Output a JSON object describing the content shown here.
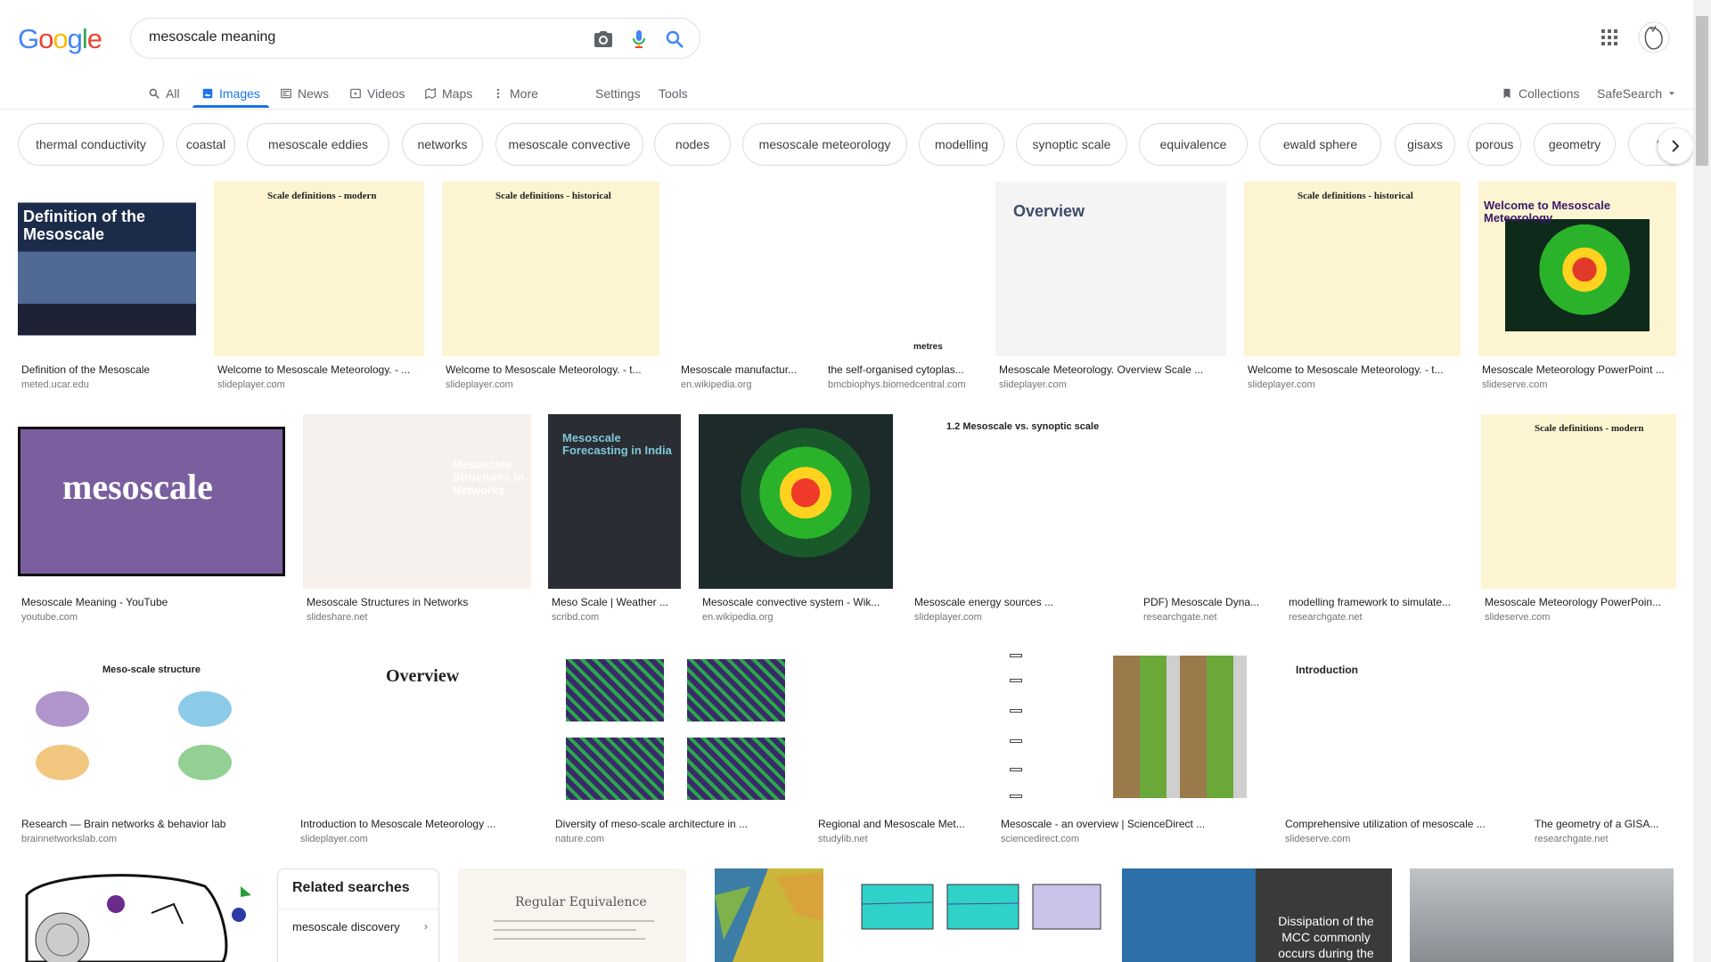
{
  "logo": [
    "G",
    "o",
    "o",
    "g",
    "l",
    "e"
  ],
  "logo_colors": [
    "#4285f4",
    "#ea4335",
    "#fbbc05",
    "#4285f4",
    "#34a853",
    "#ea4335"
  ],
  "search": {
    "query": "mesoscale meaning"
  },
  "nav": {
    "all": "All",
    "images": "Images",
    "news": "News",
    "videos": "Videos",
    "maps": "Maps",
    "more": "More",
    "settings": "Settings",
    "tools": "Tools",
    "collections": "Collections",
    "safesearch": "SafeSearch"
  },
  "chips": [
    "thermal conductivity",
    "coastal",
    "mesoscale eddies",
    "networks",
    "mesoscale convective",
    "nodes",
    "mesoscale meteorology",
    "modelling",
    "synoptic scale",
    "equivalence",
    "ewald sphere",
    "gisaxs",
    "porous",
    "geometry",
    "for"
  ],
  "results": [
    {
      "cap": "Definition of the Mesoscale",
      "src": "meted.ucar.edu",
      "thumb": "Definition of the Mesoscale"
    },
    {
      "cap": "Welcome to Mesoscale Meteorology. - ...",
      "src": "slideplayer.com",
      "thumb": "Scale definitions - modern"
    },
    {
      "cap": "Welcome to Mesoscale Meteorology. - t...",
      "src": "slideplayer.com",
      "thumb": "Scale definitions - historical"
    },
    {
      "cap": "Mesoscale manufactur...",
      "src": "en.wikipedia.org",
      "thumb": ""
    },
    {
      "cap": "the self-organised cytoplas...",
      "src": "bmcbiophys.biomedcentral.com",
      "thumb": "metres"
    },
    {
      "cap": "Mesoscale Meteorology. Overview Scale ...",
      "src": "slideplayer.com",
      "thumb": "Overview"
    },
    {
      "cap": "Welcome to Mesoscale Meteorology. - t...",
      "src": "slideplayer.com",
      "thumb": "Scale definitions - historical"
    },
    {
      "cap": "Mesoscale Meteorology PowerPoint ...",
      "src": "slideserve.com",
      "thumb": "Welcome to Mesoscale Meteorology"
    },
    {
      "cap": "Mesoscale Meaning - YouTube",
      "src": "youtube.com",
      "thumb": "mesoscale"
    },
    {
      "cap": "Mesoscale Structures in Networks",
      "src": "slideshare.net",
      "thumb": "Mesoscale Structures in Networks"
    },
    {
      "cap": "Meso Scale | Weather ...",
      "src": "scribd.com",
      "thumb": "Mesoscale Forecasting in India"
    },
    {
      "cap": "Mesoscale convective system - Wik...",
      "src": "en.wikipedia.org",
      "thumb": ""
    },
    {
      "cap": "Mesoscale energy sources ...",
      "src": "slideplayer.com",
      "thumb": "1.2 Mesoscale vs. synoptic scale"
    },
    {
      "cap": "PDF) Mesoscale Dyna...",
      "src": "researchgate.net",
      "thumb": ""
    },
    {
      "cap": "modelling framework to simulate...",
      "src": "researchgate.net",
      "thumb": ""
    },
    {
      "cap": "Mesoscale Meteorology PowerPoin...",
      "src": "slideserve.com",
      "thumb": "Scale definitions - modern"
    },
    {
      "cap": "Research — Brain networks & behavior lab",
      "src": "brainnetworkslab.com",
      "thumb": "Meso-scale structure"
    },
    {
      "cap": "Introduction to Mesoscale Meteorology ...",
      "src": "slideplayer.com",
      "thumb": "Overview"
    },
    {
      "cap": "Diversity of meso-scale architecture in ...",
      "src": "nature.com",
      "thumb": ""
    },
    {
      "cap": "Regional and Mesoscale Met...",
      "src": "studylib.net",
      "thumb": ""
    },
    {
      "cap": "Mesoscale - an overview | ScienceDirect ...",
      "src": "sciencedirect.com",
      "thumb": ""
    },
    {
      "cap": "Comprehensive utilization of mesoscale ...",
      "src": "slideserve.com",
      "thumb": "Introduction"
    },
    {
      "cap": "The geometry of a GISA...",
      "src": "researchgate.net",
      "thumb": ""
    }
  ],
  "bottom_row": {
    "related_title": "Related searches",
    "related_item": "mesoscale discovery",
    "equivalence_thumb": "Regular Equivalence",
    "cloud_text": "Dissipation of the MCC commonly occurs during the"
  }
}
